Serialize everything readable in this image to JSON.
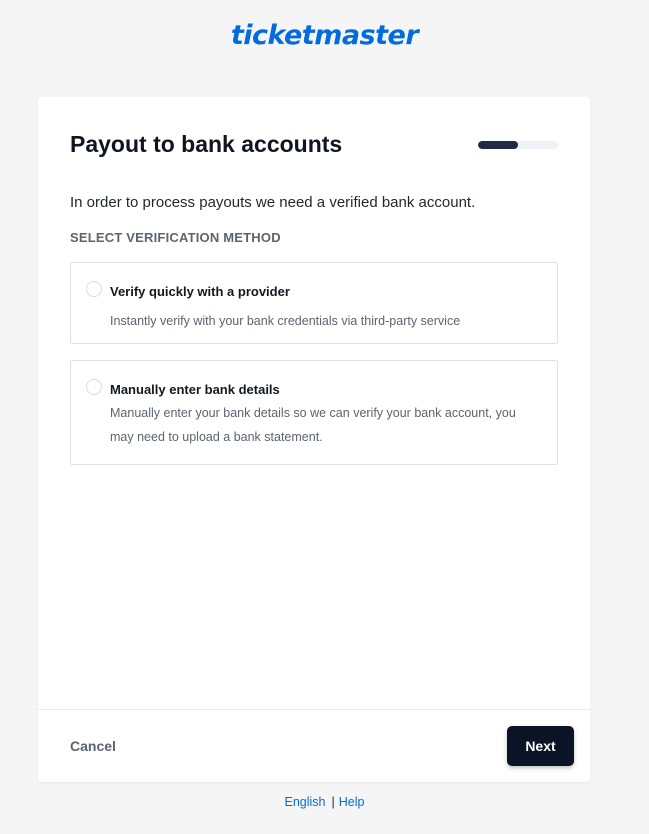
{
  "brand": {
    "logo_text": "ticketmaster",
    "color": "#026cdf"
  },
  "card": {
    "title": "Payout to bank accounts",
    "progress": 0.5,
    "intro": "In order to process payouts we need a verified bank account.",
    "section_label": "SELECT VERIFICATION METHOD",
    "options": [
      {
        "title": "Verify quickly with a provider",
        "description": "Instantly verify with your bank credentials via third-party service",
        "selected": false
      },
      {
        "title": "Manually enter bank details",
        "description": "Manually enter your bank details so we can verify your bank account, you may need to upload a bank statement.",
        "selected": false
      }
    ]
  },
  "footer": {
    "cancel_label": "Cancel",
    "next_label": "Next"
  },
  "links": {
    "language": "English",
    "separator": "|",
    "help": "Help"
  }
}
